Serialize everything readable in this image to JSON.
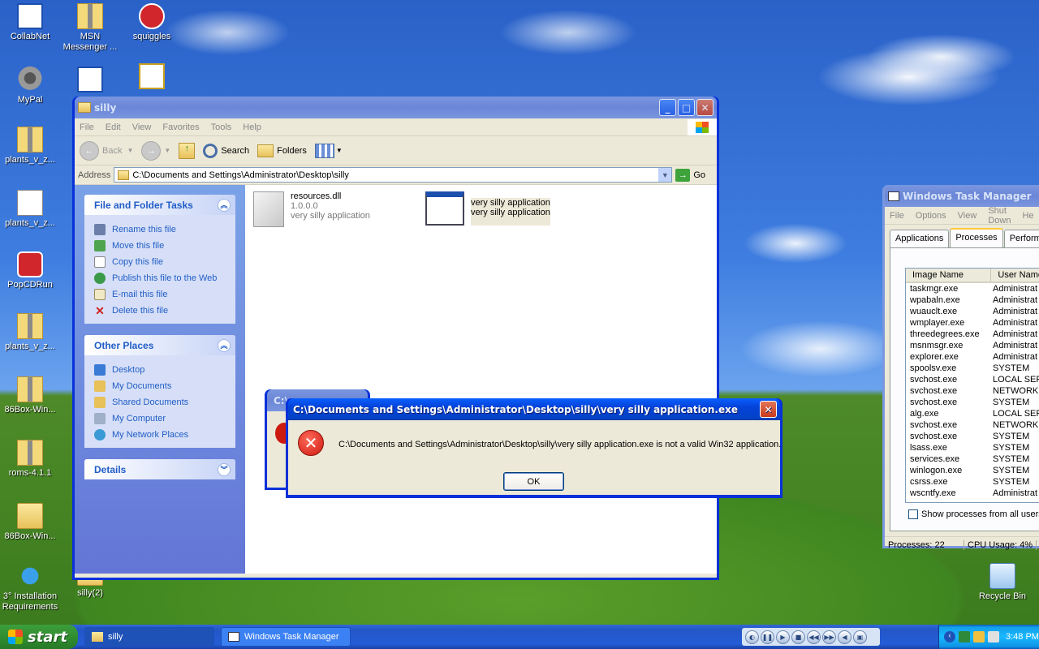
{
  "desktop": {
    "icons": [
      {
        "label": "CollabNet"
      },
      {
        "label": "MSN Messenger ..."
      },
      {
        "label": "squiggles"
      },
      {
        "label": "MyPal"
      },
      {
        "label": "plants_v_z..."
      },
      {
        "label": "plants_v_z..."
      },
      {
        "label": "PopCDRun"
      },
      {
        "label": "plants_v_z..."
      },
      {
        "label": "86Box-Win..."
      },
      {
        "label": "roms-4.1.1"
      },
      {
        "label": "86Box-Win..."
      },
      {
        "label": "3° Installation Requirements"
      },
      {
        "label": "silly(2)"
      },
      {
        "label": "Recycle Bin"
      }
    ]
  },
  "explorer": {
    "title": "silly",
    "menu": [
      "File",
      "Edit",
      "View",
      "Favorites",
      "Tools",
      "Help"
    ],
    "toolbar": {
      "back": "Back",
      "search": "Search",
      "folders": "Folders"
    },
    "address_label": "Address",
    "address_value": "C:\\Documents and Settings\\Administrator\\Desktop\\silly",
    "go_label": "Go",
    "file_tasks": {
      "title": "File and Folder Tasks",
      "items": [
        "Rename this file",
        "Move this file",
        "Copy this file",
        "Publish this file to the Web",
        "E-mail this file",
        "Delete this file"
      ]
    },
    "other_places": {
      "title": "Other Places",
      "items": [
        "Desktop",
        "My Documents",
        "Shared Documents",
        "My Computer",
        "My Network Places"
      ]
    },
    "details": {
      "title": "Details"
    },
    "files": [
      {
        "name": "resources.dll",
        "line2": "1.0.0.0",
        "line3": "very silly application"
      },
      {
        "name": "very silly application",
        "line2": "very silly application"
      }
    ]
  },
  "back_dialog": {
    "title": "C:\\"
  },
  "dialog": {
    "title": "C:\\Documents and Settings\\Administrator\\Desktop\\silly\\very silly application.exe",
    "message": "C:\\Documents and Settings\\Administrator\\Desktop\\silly\\very silly application.exe is not a valid Win32 application.",
    "ok_label": "OK"
  },
  "taskmanager": {
    "title": "Windows Task Manager",
    "menu": [
      "File",
      "Options",
      "View",
      "Shut Down",
      "He"
    ],
    "tabs": [
      "Applications",
      "Processes",
      "Performan"
    ],
    "columns": [
      "Image Name",
      "User Name"
    ],
    "processes": [
      {
        "name": "taskmgr.exe",
        "user": "Administrat"
      },
      {
        "name": "wpabaln.exe",
        "user": "Administrat"
      },
      {
        "name": "wuauclt.exe",
        "user": "Administrat"
      },
      {
        "name": "wmplayer.exe",
        "user": "Administrat"
      },
      {
        "name": "threedegrees.exe",
        "user": "Administrat"
      },
      {
        "name": "msnmsgr.exe",
        "user": "Administrat"
      },
      {
        "name": "explorer.exe",
        "user": "Administrat"
      },
      {
        "name": "spoolsv.exe",
        "user": "SYSTEM"
      },
      {
        "name": "svchost.exe",
        "user": "LOCAL SER"
      },
      {
        "name": "svchost.exe",
        "user": "NETWORK"
      },
      {
        "name": "svchost.exe",
        "user": "SYSTEM"
      },
      {
        "name": "alg.exe",
        "user": "LOCAL SER"
      },
      {
        "name": "svchost.exe",
        "user": "NETWORK"
      },
      {
        "name": "svchost.exe",
        "user": "SYSTEM"
      },
      {
        "name": "lsass.exe",
        "user": "SYSTEM"
      },
      {
        "name": "services.exe",
        "user": "SYSTEM"
      },
      {
        "name": "winlogon.exe",
        "user": "SYSTEM"
      },
      {
        "name": "csrss.exe",
        "user": "SYSTEM"
      },
      {
        "name": "wscntfy.exe",
        "user": "Administrat"
      }
    ],
    "show_all": "Show processes from all users",
    "status_processes": "Processes: 22",
    "status_cpu": "CPU Usage: 4%"
  },
  "taskbar": {
    "start": "start",
    "items": [
      {
        "label": "silly"
      },
      {
        "label": "Windows Task Manager"
      }
    ],
    "clock": "3:48 PM"
  }
}
